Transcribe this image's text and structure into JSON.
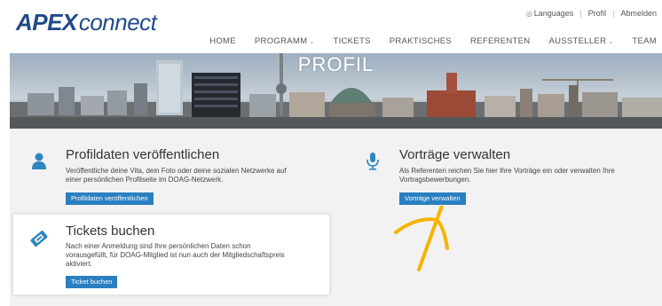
{
  "logo": {
    "apex": "APEX",
    "connect": "connect"
  },
  "toplinks": {
    "languages": "Languages",
    "profil": "Profil",
    "abmelden": "Abmelden"
  },
  "nav": {
    "items": [
      {
        "label": "HOME",
        "dropdown": false
      },
      {
        "label": "PROGRAMM",
        "dropdown": true
      },
      {
        "label": "TICKETS",
        "dropdown": false
      },
      {
        "label": "PRAKTISCHES",
        "dropdown": false
      },
      {
        "label": "REFERENTEN",
        "dropdown": false
      },
      {
        "label": "AUSSTELLER",
        "dropdown": true
      },
      {
        "label": "TEAM",
        "dropdown": false
      }
    ]
  },
  "banner": {
    "title": "PROFIL"
  },
  "cards": {
    "profildaten": {
      "title": "Profildaten veröffentlichen",
      "text_line1": "Veröffentliche deine Vita, dein Foto oder deine sozialen Netzwerke auf",
      "text_line2": "einer persönlichen Profilseite im DOAG-Netzwerk.",
      "button": "Profildaten veröffentlichen",
      "icon": "user-icon"
    },
    "vortraege": {
      "title": "Vorträge verwalten",
      "text_line1": "Als Referenten reichen Sie hier Ihre Vorträge ein oder verwalten Ihre",
      "text_line2": "Vortragsbewerbungen.",
      "button": "Vorträge verwalten",
      "icon": "microphone-icon"
    },
    "tickets": {
      "title": "Tickets buchen",
      "text_line1": "Nach einer Anmeldung sind Ihre persönlichen Daten schon",
      "text_line2": "vorausgefüllt, für DOAG-Mitglied ist nun auch der Mitgliedschaftspreis",
      "text_line3": "aktiviert.",
      "button": "Ticket buchen",
      "icon": "ticket-icon"
    }
  },
  "colors": {
    "brand": "#1f4a8a",
    "button": "#2a7fc0",
    "icon": "#2e86c1",
    "annotation": "#f5b400"
  }
}
